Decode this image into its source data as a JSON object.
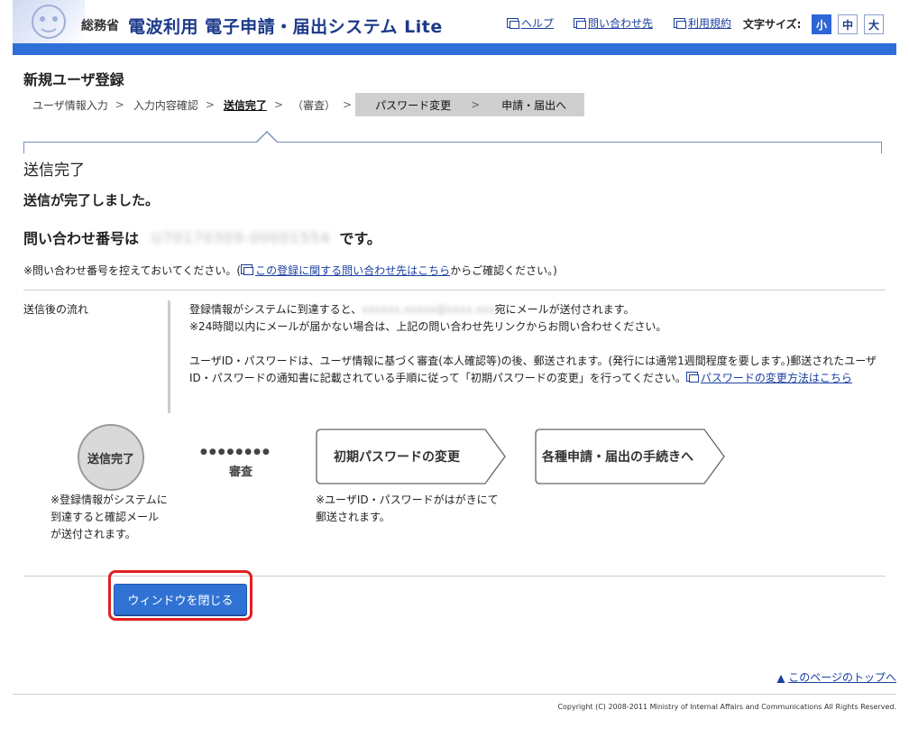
{
  "header": {
    "ministry": "総務省",
    "system_title": "電波利用 電子申請・届出システム Lite",
    "links": {
      "help": "ヘルプ",
      "contact": "問い合わせ先",
      "terms": "利用規約"
    },
    "font_size_label": "文字サイズ:",
    "font_sizes": [
      "小",
      "中",
      "大"
    ],
    "font_size_selected": "小"
  },
  "page_title": "新規ユーザ登録",
  "steps": [
    "ユーザ情報入力",
    "入力内容確認",
    "送信完了",
    "（審査）",
    "パスワード変更",
    "申請・届出へ"
  ],
  "current_step": "送信完了",
  "section_title": "送信完了",
  "done_message": "送信が完了しました。",
  "inquiry": {
    "prefix": "問い合わせ番号は",
    "number": "U70170309-00001554",
    "suffix": "です。"
  },
  "note": {
    "before": "※問い合わせ番号を控えておいてください。(",
    "link": "この登録に関する問い合わせ先はこちら",
    "after": "からご確認ください。)"
  },
  "flow": {
    "label": "送信後の流れ",
    "line1_before": "登録情報がシステムに到達すると、",
    "email_blurred": "xxxxxx.xxxxx@xxxx.xxx",
    "line1_after": "宛にメールが送付されます。",
    "line2": "※24時間以内にメールが届かない場合は、上記の問い合わせ先リンクからお問い合わせください。",
    "para2": "ユーザID・パスワードは、ユーザ情報に基づく審査(本人確認等)の後、郵送されます。(発行には通常1週間程度を要します。)郵送されたユーザID・パスワードの通知書に記載されている手順に従って「初期パスワードの変更」を行ってください。",
    "para2_link": "パスワードの変更方法はこちら"
  },
  "diagram": {
    "circle_label": "送信完了",
    "circle_note": "※登録情報がシステムに到達すると確認メールが送付されます。",
    "dots": "●●●●●●●●",
    "review_label": "審査",
    "box1": "初期パスワードの変更",
    "box1_note": "※ユーザID・パスワードがはがきにて郵送されます。",
    "box2": "各種申請・届出の手続きへ"
  },
  "close_button": "ウィンドウを閉じる",
  "to_top": "このページのトップへ",
  "copyright": "Copyright (C) 2008-2011 Ministry of Internal Affairs and Communications All Rights Reserved."
}
